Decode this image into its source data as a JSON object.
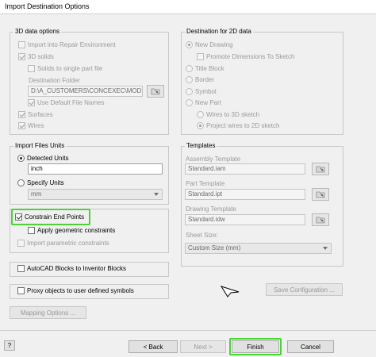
{
  "window": {
    "title": "Import Destination Options"
  },
  "data3d": {
    "group_label": "3D data options",
    "import_repair": "Import into Repair Environment",
    "solids": "3D solids",
    "solids_single": "Solids to single part file",
    "dest_folder_label": "Destination Folder",
    "dest_folder_value": "D:\\A_CUSTOMERS\\CONCEXEC\\MODELO_I",
    "use_default": "Use Default File Names",
    "surfaces": "Surfaces",
    "wires": "Wires"
  },
  "dest2d": {
    "group_label": "Destination for 2D data",
    "new_drawing": "New Drawing",
    "promote_dims": "Promote Dimensions To Sketch",
    "title_block": "Title Block",
    "border": "Border",
    "symbol": "Symbol",
    "new_part": "New Part",
    "wires_3d": "Wires to 3D sketch",
    "project_wires": "Project wires to 2D sketch"
  },
  "units": {
    "group_label": "Import Files Units",
    "detected": "Detected Units",
    "detected_value": "inch",
    "specify": "Specify Units",
    "specify_value": "mm"
  },
  "templates": {
    "group_label": "Templates",
    "assembly_label": "Assembly Template",
    "assembly_value": "Standard.iam",
    "part_label": "Part Template",
    "part_value": "Standard.ipt",
    "drawing_label": "Drawing Template",
    "drawing_value": "Standard.idw",
    "sheet_label": "Sheet Size:",
    "sheet_value": "Custom Size (mm)"
  },
  "constraints": {
    "constrain_end": "Constrain End Points",
    "apply_geometric": "Apply geometric constraints",
    "import_parametric": "Import parametric constraints"
  },
  "autocad_blocks": "AutoCAD Blocks to Inventor Blocks",
  "proxy_objects": "Proxy objects to user defined symbols",
  "buttons": {
    "mapping": "Mapping Options ...",
    "save_config": "Save Configuration ...",
    "help": "?",
    "back": "< Back",
    "next": "Next >",
    "finish": "Finish",
    "cancel": "Cancel"
  },
  "colors": {
    "highlight": "#4cd137"
  }
}
